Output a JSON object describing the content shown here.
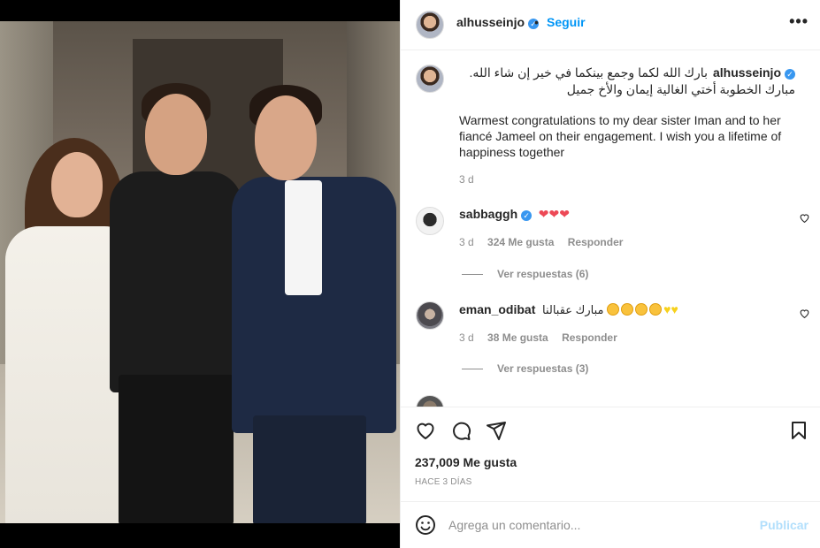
{
  "post": {
    "author": "alhusseinjo",
    "follow_label": "Seguir",
    "dot": "•",
    "more_label": "•••",
    "caption_arabic": "بارك الله لكما وجمع بينكما في خير إن شاء الله. مبارك الخطوبة أختي الغالية إيمان والأخ جميل",
    "caption_english": "Warmest congratulations to my dear sister Iman and to her fiancé Jameel on their engagement. I wish you a lifetime of happiness together",
    "caption_time": "3 d"
  },
  "comments": [
    {
      "user": "sabbaggh",
      "verified": true,
      "text_emojis": "❤❤❤",
      "time": "3 d",
      "likes": "324 Me gusta",
      "reply_label": "Responder",
      "replies_label": "Ver respuestas (6)"
    },
    {
      "user": "eman_odibat",
      "verified": false,
      "text": "مبارك عقبالنا",
      "time": "3 d",
      "likes": "38 Me gusta",
      "reply_label": "Responder",
      "replies_label": "Ver respuestas (3)"
    }
  ],
  "engagement": {
    "likes": "237,009 Me gusta",
    "posted_ago": "HACE 3 DÍAS"
  },
  "comment_box": {
    "placeholder": "Agrega un comentario...",
    "publish_label": "Publicar"
  },
  "colors": {
    "accent": "#0095f6",
    "verified": "#3897f0",
    "publish_disabled": "#b2dffc",
    "heart_red": "#ed4956"
  },
  "icons": [
    "verified-badge-icon",
    "more-options-icon",
    "heart-icon",
    "comment-icon",
    "share-icon",
    "save-bookmark-icon",
    "emoji-smiley-icon"
  ]
}
